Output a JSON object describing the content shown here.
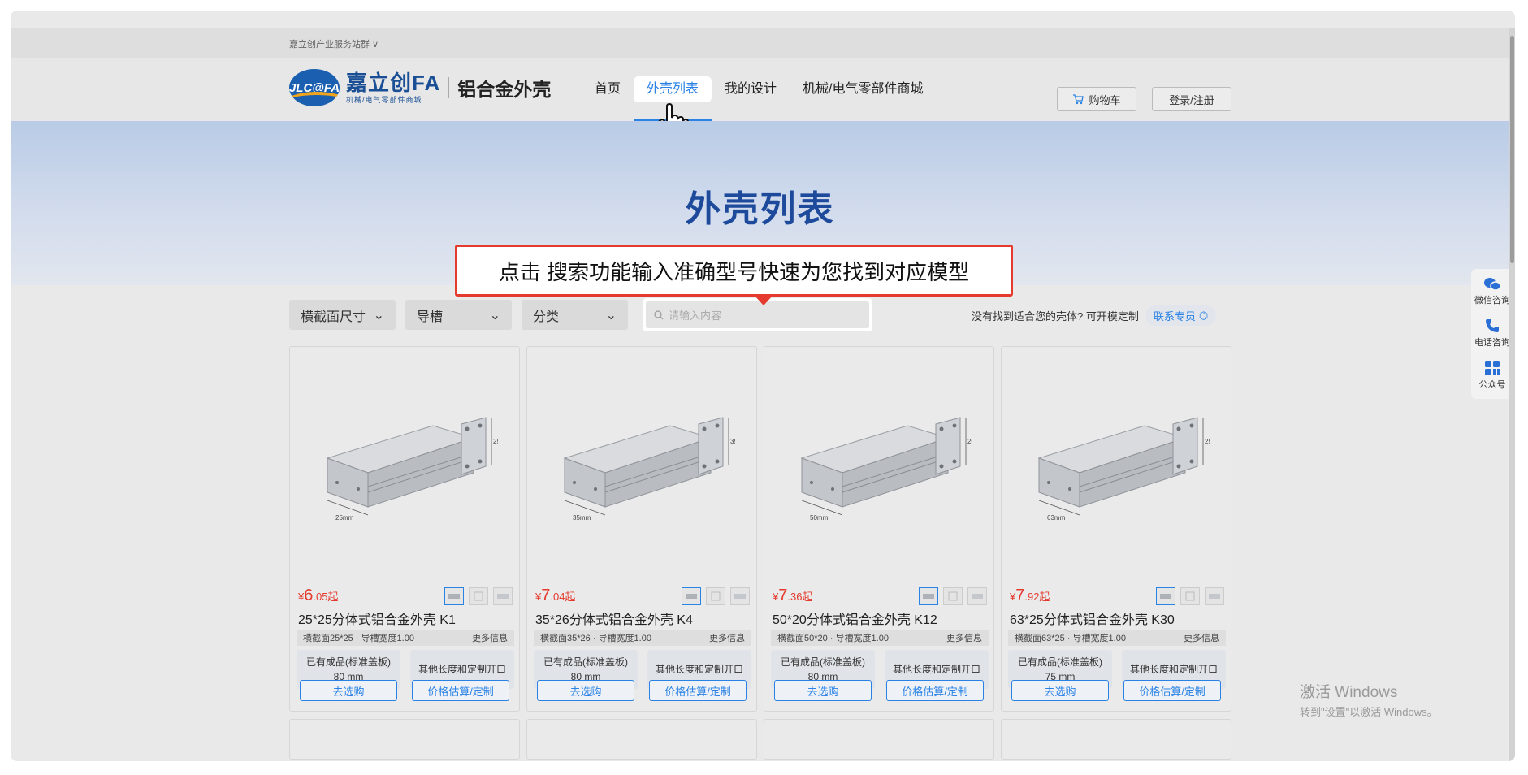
{
  "top_strip": {
    "label": "嘉立创产业服务站群 ∨"
  },
  "nav": {
    "logo_badge": "JLC@FA",
    "logo_main": "嘉立创FA",
    "logo_sub": "机械/电气零部件商城",
    "product_title": "铝合金外壳",
    "items": [
      {
        "label": "首页"
      },
      {
        "label": "外壳列表",
        "active": true
      },
      {
        "label": "我的设计"
      },
      {
        "label": "机械/电气零部件商城"
      }
    ],
    "cart_label": "购物车",
    "login_label": "登录/注册"
  },
  "banner": {
    "title": "外壳列表"
  },
  "callout": {
    "text": "点击 搜索功能输入准确型号快速为您找到对应模型"
  },
  "filters": {
    "selects": [
      {
        "label": "横截面尺寸"
      },
      {
        "label": "导槽"
      },
      {
        "label": "分类"
      }
    ],
    "search_placeholder": "请输入内容",
    "hint": "没有找到适合您的壳体? 可开模定制",
    "contact_label": "联系专员"
  },
  "products": [
    {
      "price_symbol": "¥",
      "price_int": "6",
      "price_dec": ".05起",
      "title": "25*25分体式铝合金外壳 K1",
      "spec": "横截面25*25 · 导槽宽度1.00",
      "more": "更多信息",
      "opt_left_line1": "已有成品(标准盖板)",
      "opt_left_line2": "80 mm",
      "opt_right": "其他长度和定制开口",
      "btn_buy": "去选购",
      "btn_quote": "价格估算/定制",
      "dim_label": "25mm",
      "dim_width": "25mm"
    },
    {
      "price_symbol": "¥",
      "price_int": "7",
      "price_dec": ".04起",
      "title": "35*26分体式铝合金外壳 K4",
      "spec": "横截面35*26 · 导槽宽度1.00",
      "more": "更多信息",
      "opt_left_line1": "已有成品(标准盖板)",
      "opt_left_line2": "80 mm",
      "opt_right": "其他长度和定制开口",
      "btn_buy": "去选购",
      "btn_quote": "价格估算/定制",
      "dim_label": "35.8mm",
      "dim_width": "35mm"
    },
    {
      "price_symbol": "¥",
      "price_int": "7",
      "price_dec": ".36起",
      "title": "50*20分体式铝合金外壳 K12",
      "spec": "横截面50*20 · 导槽宽度1.00",
      "more": "更多信息",
      "opt_left_line1": "已有成品(标准盖板)",
      "opt_left_line2": "80 mm",
      "opt_right": "其他长度和定制开口",
      "btn_buy": "去选购",
      "btn_quote": "价格估算/定制",
      "dim_label": "20mm",
      "dim_width": "50mm"
    },
    {
      "price_symbol": "¥",
      "price_int": "7",
      "price_dec": ".92起",
      "title": "63*25分体式铝合金外壳 K30",
      "spec": "横截面63*25 · 导槽宽度1.00",
      "more": "更多信息",
      "opt_left_line1": "已有成品(标准盖板)",
      "opt_left_line2": "75 mm",
      "opt_right": "其他长度和定制开口",
      "btn_buy": "去选购",
      "btn_quote": "价格估算/定制",
      "dim_label": "25mm",
      "dim_width": "63mm"
    }
  ],
  "side": {
    "items": [
      {
        "label": "微信咨询",
        "icon": "wechat-icon"
      },
      {
        "label": "电话咨询",
        "icon": "phone-icon"
      },
      {
        "label": "公众号",
        "icon": "grid-icon"
      }
    ]
  },
  "watermark": {
    "line1": "激活 Windows",
    "line2": "转到\"设置\"以激活 Windows。"
  },
  "colors": {
    "accent": "#2a82e4",
    "price": "#e53a2e",
    "brand": "#1a4f95",
    "callout_border": "#e53a2e"
  }
}
